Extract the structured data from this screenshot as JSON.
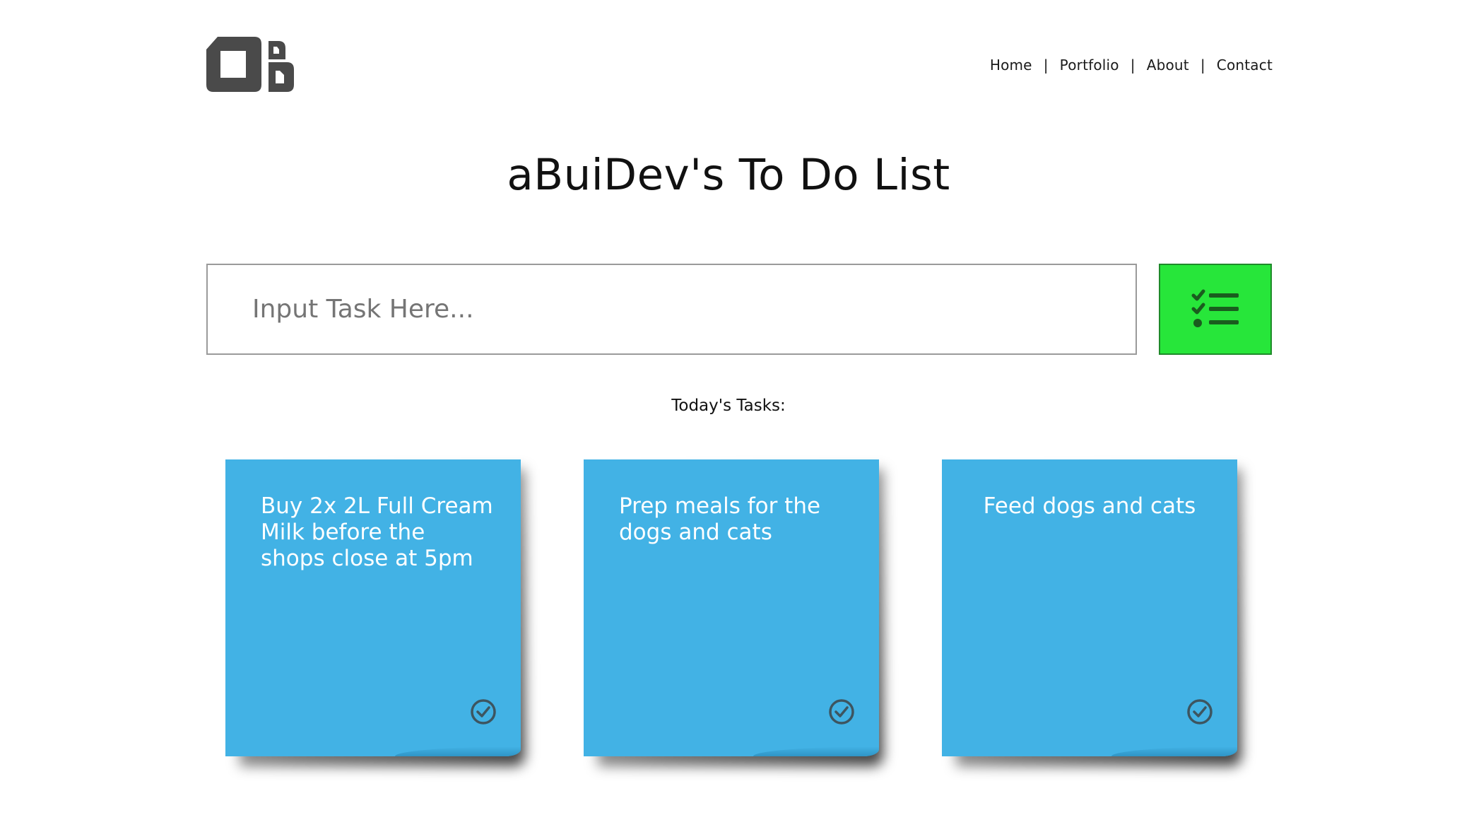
{
  "header": {
    "logo_icon": "abuidev-logo-icon",
    "nav": [
      {
        "label": "Home"
      },
      {
        "label": "Portfolio"
      },
      {
        "label": "About"
      },
      {
        "label": "Contact"
      }
    ],
    "separator": "|"
  },
  "main": {
    "title": "aBuiDev's To Do List",
    "input": {
      "placeholder": "Input Task Here...",
      "value": ""
    },
    "add_button": {
      "icon": "checklist-icon",
      "color": "#27e63a"
    },
    "section_label": "Today's Tasks:",
    "tasks": [
      {
        "text": "Buy 2x 2L Full Cream Milk before the shops close at 5pm",
        "icon": "check-circle-icon"
      },
      {
        "text": "Prep meals for the dogs and cats",
        "icon": "check-circle-icon"
      },
      {
        "text": "Feed dogs and cats",
        "icon": "check-circle-icon"
      }
    ],
    "note_color": "#42b2e5"
  }
}
